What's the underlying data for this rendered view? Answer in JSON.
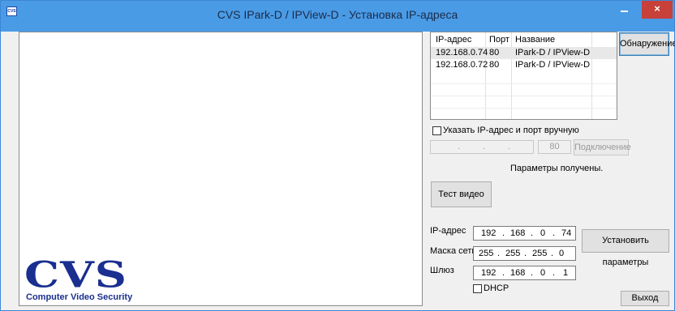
{
  "window": {
    "title": "CVS IPark-D / IPView-D  -  Установка IP-адреса",
    "icon_text": "CVS",
    "controls": {
      "minimize_icon": "minimize-icon",
      "maximize_icon": "maximize-icon",
      "close_glyph": "×"
    }
  },
  "logo": {
    "main": "CVS",
    "sub": "Computer Video Security"
  },
  "device_list": {
    "columns": [
      "IP-адрес",
      "Порт",
      "Название"
    ],
    "rows": [
      [
        "192.168.0.74",
        "80",
        "IPark-D / IPView-D"
      ],
      [
        "192.168.0.72",
        "80",
        "IPark-D / IPView-D"
      ]
    ]
  },
  "buttons": {
    "discover": "Обнаружение",
    "connect": "Подключение",
    "test_video": "Тест видео",
    "set_params": "Установить параметры",
    "exit": "Выход"
  },
  "manual": {
    "checkbox_label": "Указать IP-адрес и порт вручную",
    "ip_dots": ".",
    "port": "80"
  },
  "status": "Параметры получены.",
  "params": {
    "ip_label": "IP-адрес",
    "mask_label": "Маска сети",
    "gateway_label": "Шлюз",
    "ip": [
      "192",
      "168",
      "0",
      "74"
    ],
    "mask": [
      "255",
      "255",
      "255",
      "0"
    ],
    "gateway": [
      "192",
      "168",
      "0",
      "1"
    ],
    "octet_sep": ".",
    "dhcp_label": "DHCP"
  }
}
